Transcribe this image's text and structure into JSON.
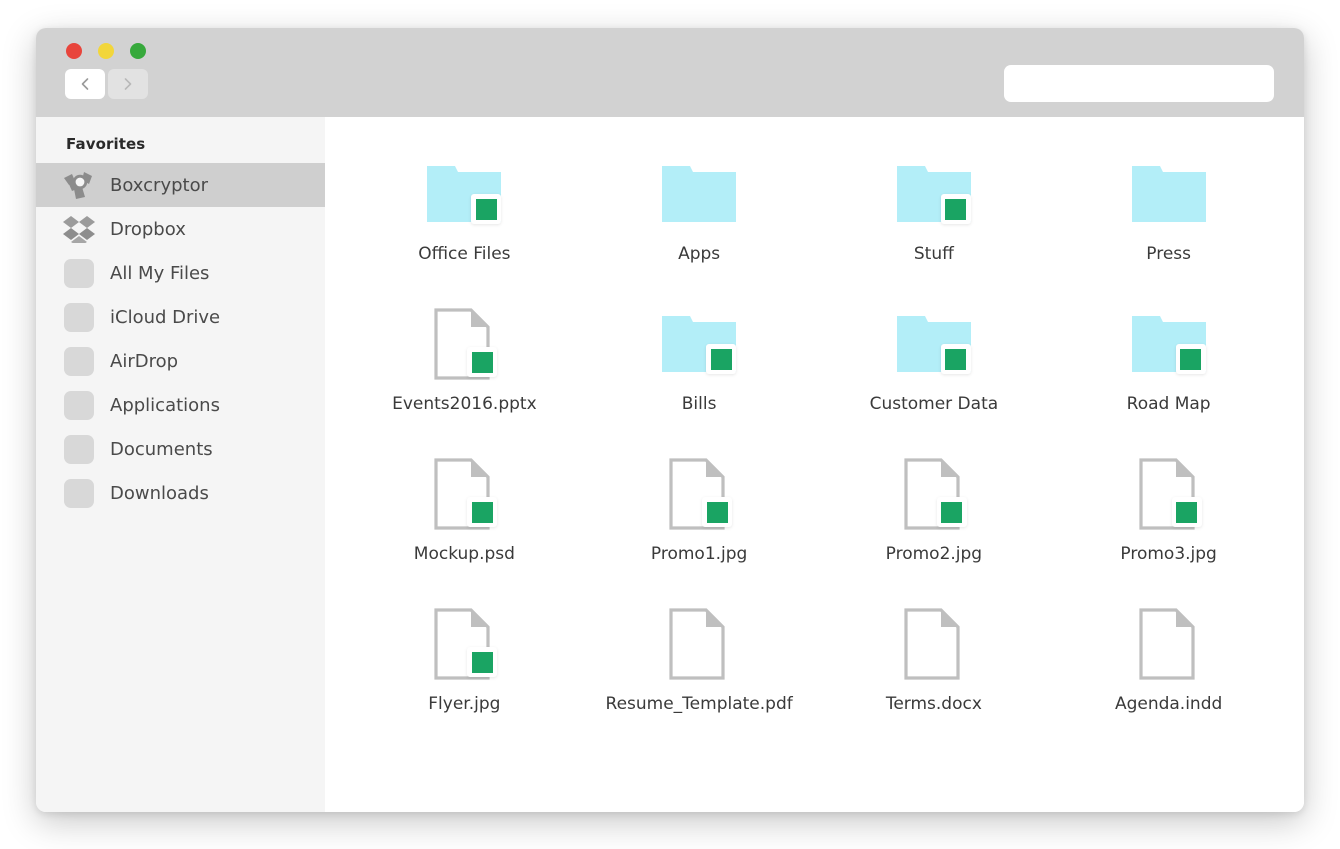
{
  "window": {
    "traffic_lights": [
      {
        "name": "close",
        "color": "#e8453c"
      },
      {
        "name": "minimize",
        "color": "#f2d63b"
      },
      {
        "name": "maximize",
        "color": "#37a93c"
      }
    ],
    "nav": {
      "back_label": "‹",
      "forward_label": "›"
    },
    "search": {
      "value": "",
      "placeholder": ""
    }
  },
  "sidebar": {
    "heading": "Favorites",
    "items": [
      {
        "label": "Boxcryptor",
        "icon": "boxcryptor-icon",
        "selected": true
      },
      {
        "label": "Dropbox",
        "icon": "dropbox-icon",
        "selected": false
      },
      {
        "label": "All My Files",
        "icon": "generic-icon",
        "selected": false
      },
      {
        "label": "iCloud Drive",
        "icon": "generic-icon",
        "selected": false
      },
      {
        "label": "AirDrop",
        "icon": "generic-icon",
        "selected": false
      },
      {
        "label": "Applications",
        "icon": "generic-icon",
        "selected": false
      },
      {
        "label": "Documents",
        "icon": "generic-icon",
        "selected": false
      },
      {
        "label": "Downloads",
        "icon": "generic-icon",
        "selected": false
      }
    ]
  },
  "colors": {
    "titlebar": "#d2d2d2",
    "sidebar": "#f5f5f5",
    "sidebar_selected": "#cfcfcf",
    "folder": "#b3eef8",
    "document_outline": "#bfbfbf",
    "badge_green": "#1aa463",
    "content": "#ffffff"
  },
  "files": [
    {
      "label": "Office Files",
      "type": "folder",
      "encrypted": true
    },
    {
      "label": "Apps",
      "type": "folder",
      "encrypted": false
    },
    {
      "label": "Stuff",
      "type": "folder",
      "encrypted": true
    },
    {
      "label": "Press",
      "type": "folder",
      "encrypted": false
    },
    {
      "label": "Events2016.pptx",
      "type": "document",
      "encrypted": true
    },
    {
      "label": "Bills",
      "type": "folder",
      "encrypted": true
    },
    {
      "label": "Customer Data",
      "type": "folder",
      "encrypted": true
    },
    {
      "label": "Road Map",
      "type": "folder",
      "encrypted": true
    },
    {
      "label": "Mockup.psd",
      "type": "document",
      "encrypted": true
    },
    {
      "label": "Promo1.jpg",
      "type": "document",
      "encrypted": true
    },
    {
      "label": "Promo2.jpg",
      "type": "document",
      "encrypted": true
    },
    {
      "label": "Promo3.jpg",
      "type": "document",
      "encrypted": true
    },
    {
      "label": "Flyer.jpg",
      "type": "document",
      "encrypted": true
    },
    {
      "label": "Resume_Template.pdf",
      "type": "document",
      "encrypted": false
    },
    {
      "label": "Terms.docx",
      "type": "document",
      "encrypted": false
    },
    {
      "label": "Agenda.indd",
      "type": "document",
      "encrypted": false
    }
  ]
}
